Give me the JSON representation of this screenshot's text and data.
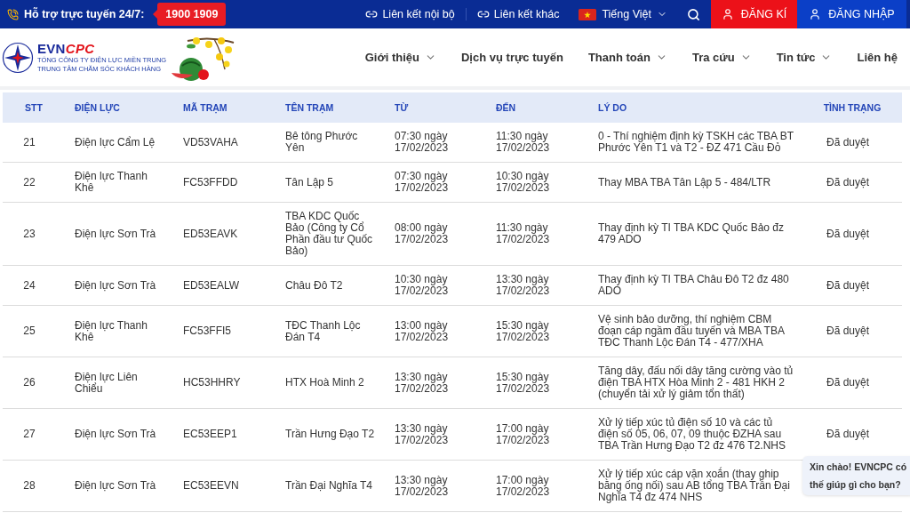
{
  "topbar": {
    "support_label": "Hỗ trợ trực tuyến 24/7:",
    "hotline": "1900 1909",
    "links": [
      {
        "label": "Liên kết nội bộ"
      },
      {
        "label": "Liên kết khác"
      }
    ],
    "language": {
      "label": "Tiếng Việt"
    },
    "buttons": [
      {
        "label": "ĐĂNG KÍ",
        "kind": "register"
      },
      {
        "label": "ĐĂNG NHẬP",
        "kind": "login"
      }
    ]
  },
  "header": {
    "brand_prefix": "EVN",
    "brand_suffix": "CPC",
    "subtitle_lines": [
      "TỔNG CÔNG TY ĐIỆN LỰC MIỀN TRUNG",
      "TRUNG TÂM CHĂM SÓC KHÁCH HÀNG"
    ],
    "nav": [
      {
        "label": "Giới thiệu",
        "dropdown": true
      },
      {
        "label": "Dịch vụ trực tuyến",
        "dropdown": false
      },
      {
        "label": "Thanh toán",
        "dropdown": true
      },
      {
        "label": "Tra cứu",
        "dropdown": true
      },
      {
        "label": "Tin tức",
        "dropdown": true
      },
      {
        "label": "Liên hệ",
        "dropdown": false
      }
    ]
  },
  "table": {
    "columns": [
      "STT",
      "ĐIỆN LỰC",
      "MÃ TRẠM",
      "TÊN TRẠM",
      "TỪ",
      "ĐẾN",
      "LÝ DO",
      "TÌNH TRẠNG"
    ],
    "rows": [
      [
        "21",
        "Điện lực Cẩm Lệ",
        "VD53VAHA",
        "Bê tông Phước Yên",
        "07:30 ngày 17/02/2023",
        "11:30 ngày 17/02/2023",
        "0 - Thí nghiệm định kỳ TSKH các TBA BT Phước Yên T1 và T2 - ĐZ 471 Cầu Đỏ",
        "Đã duyệt"
      ],
      [
        "22",
        "Điện lực Thanh Khê",
        "FC53FFDD",
        "Tân Lập 5",
        "07:30 ngày 17/02/2023",
        "10:30 ngày 17/02/2023",
        "Thay MBA TBA Tân Lập 5 - 484/LTR",
        "Đã duyệt"
      ],
      [
        "23",
        "Điện lực Sơn Trà",
        "ED53EAVK",
        "TBA KDC Quốc Bảo (Công ty Cổ Phần đầu tư Quốc Bảo)",
        "08:00 ngày 17/02/2023",
        "11:30 ngày 17/02/2023",
        "Thay định kỳ TI TBA KDC Quốc Bảo đz 479 ADO",
        "Đã duyệt"
      ],
      [
        "24",
        "Điện lực Sơn Trà",
        "ED53EALW",
        "Châu Đô T2",
        "10:30 ngày 17/02/2023",
        "13:30 ngày 17/02/2023",
        "Thay định kỳ TI TBA Châu Đô T2 đz 480 ADO",
        "Đã duyệt"
      ],
      [
        "25",
        "Điện lực Thanh Khê",
        "FC53FFI5",
        "TĐC Thanh Lộc Đán T4",
        "13:00 ngày 17/02/2023",
        "15:30 ngày 17/02/2023",
        "Vệ sinh bảo dưỡng, thí nghiệm CBM đoạn cáp ngầm đầu tuyến và MBA TBA TĐC Thanh Lộc Đán T4 - 477/XHA",
        "Đã duyệt"
      ],
      [
        "26",
        "Điện lực Liên Chiểu",
        "HC53HHRY",
        "HTX Hoà Minh 2",
        "13:30 ngày 17/02/2023",
        "15:30 ngày 17/02/2023",
        "Tăng dây, đấu nối dây tăng cường vào tủ điện TBA HTX Hòa Minh 2 - 481 HKH 2 (chuyển tải xử lý giảm tổn thất)",
        "Đã duyệt"
      ],
      [
        "27",
        "Điện lực Sơn Trà",
        "EC53EEP1",
        "Trần Hưng Đạo T2",
        "13:30 ngày 17/02/2023",
        "17:00 ngày 17/02/2023",
        "Xử lý tiếp xúc tủ điện số 10 và các tủ điện số 05, 06, 07, 09 thuộc ĐZHA sau TBA Trần Hưng Đạo T2 đz 476 T2.NHS",
        "Đã duyệt"
      ],
      [
        "28",
        "Điện lực Sơn Trà",
        "EC53EEVN",
        "Trần Đại Nghĩa T4",
        "13:30 ngày 17/02/2023",
        "17:00 ngày 17/02/2023",
        "Xử lý tiếp xúc cáp vặn xoắn (thay ghip bằng ống nối) sau AB tổng TBA Trần Đại Nghĩa T4 đz 474 NHS",
        ""
      ]
    ]
  },
  "chat_bubble": {
    "lines": [
      "Xin chào! EVNCPC có",
      "thế giúp gì cho bạn?"
    ]
  }
}
